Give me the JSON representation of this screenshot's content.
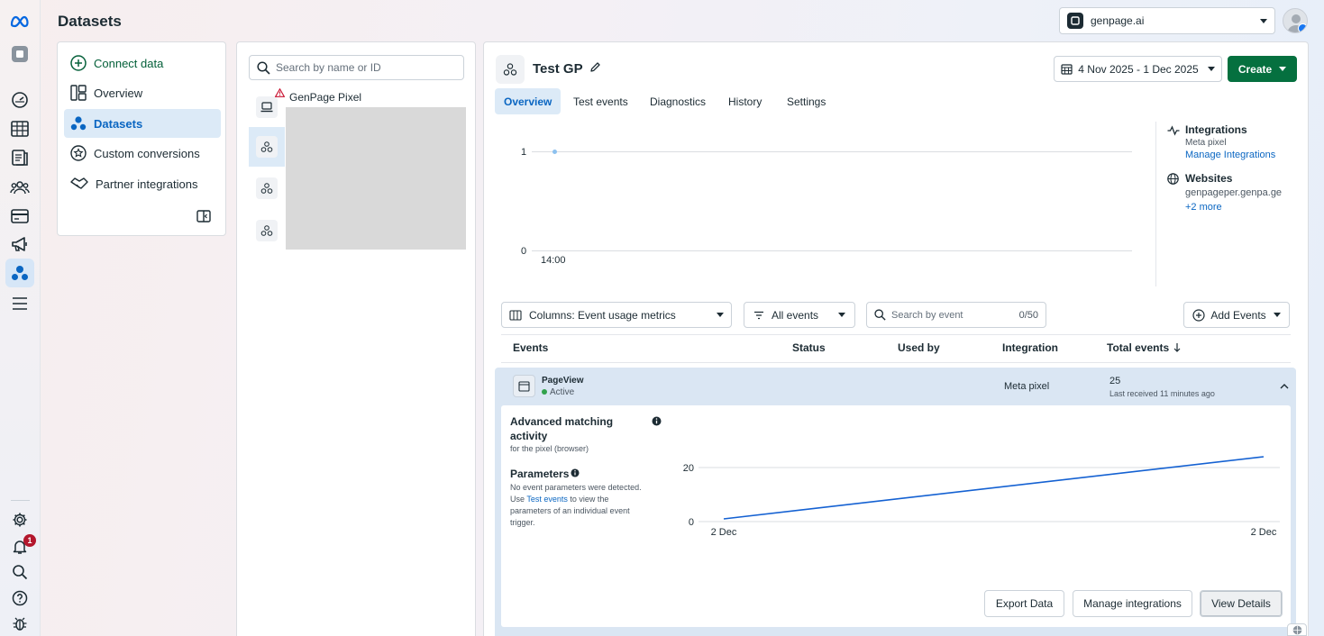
{
  "header": {
    "title": "Datasets",
    "account": "genpage.ai"
  },
  "rail": {
    "notification_count": "1"
  },
  "nav": {
    "connect": "Connect data",
    "items": [
      "Overview",
      "Datasets",
      "Custom conversions",
      "Partner integrations"
    ]
  },
  "list": {
    "search_placeholder": "Search by name or ID",
    "first_item": "GenPage Pixel"
  },
  "dataset": {
    "name": "Test GP",
    "date_range": "4 Nov 2025 - 1 Dec 2025",
    "create_label": "Create",
    "tabs": [
      "Overview",
      "Test events",
      "Diagnostics",
      "History",
      "Settings"
    ]
  },
  "overview_chart": {
    "y_ticks": [
      "1",
      "0"
    ],
    "x_tick": "14:00"
  },
  "side": {
    "integrations_title": "Integrations",
    "integrations_sub": "Meta pixel",
    "manage_link": "Manage Integrations",
    "websites_title": "Websites",
    "website": "genpageper.genpa.ge",
    "more": "+2 more"
  },
  "filters": {
    "columns": "Columns: Event usage metrics",
    "events": "All events",
    "search_placeholder": "Search by event",
    "count": "0/50",
    "add_events": "Add Events"
  },
  "table": {
    "headers": [
      "Events",
      "Status",
      "Used by",
      "Integration",
      "Total events"
    ],
    "row": {
      "name": "PageView",
      "status": "Active",
      "integration": "Meta pixel",
      "total": "25",
      "last_received": "Last received 11 minutes ago"
    }
  },
  "detail": {
    "amatch_title_1": "Advanced matching",
    "amatch_title_2": "activity",
    "amatch_sub": "for the pixel (browser)",
    "params_title": "Parameters",
    "params_text_1": "No event parameters were detected.",
    "params_text_2a": "Use ",
    "params_link": "Test events",
    "params_text_2b": " to view the",
    "params_text_3": "parameters of an individual event",
    "params_text_4": "trigger.",
    "buttons": [
      "Export Data",
      "Manage integrations",
      "View Details"
    ]
  },
  "chart_data": {
    "type": "line",
    "x": [
      "2 Dec",
      "2 Dec"
    ],
    "series": [
      {
        "values": [
          1,
          24
        ]
      }
    ],
    "y_ticks": [
      0,
      20
    ],
    "ylim": [
      0,
      25
    ],
    "color": "#1461d2",
    "grid": true
  },
  "colors": {
    "accent": "#0a66c2",
    "primary_button": "#05703f",
    "active_dot": "#31a24c",
    "badge": "#b3172d"
  }
}
